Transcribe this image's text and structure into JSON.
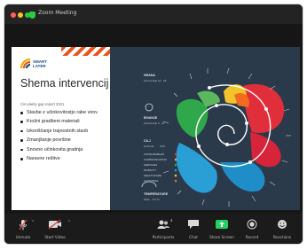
{
  "window": {
    "title": "Zoom Meeting",
    "traffic_lights": [
      "#ff5f57",
      "#febc2e",
      "#28c840"
    ]
  },
  "slide": {
    "logo": {
      "line1": "SMART",
      "line2": "LATER"
    },
    "title": "Shema intervencij",
    "subtitle": "Circularity gap report 2021",
    "bullets": [
      "Stavbe z učinkovitostjo rabe virov",
      "Krožni gradbeni materiali",
      "Izkoriščanje trajnostnih stavb",
      "Zmanjšanje površine",
      "Snovno učinkovita gradnja",
      "Naravne rešitve"
    ]
  },
  "diagram": {
    "legend": {
      "section1_title": "HRANA",
      "section1_sub": "intervencije 14 · 18",
      "section2_title": "BIVANJE",
      "section2_sub": "intervencije 6 · 21",
      "section3_title": "CILJ",
      "section3_sub": "krožnost",
      "categories": [
        "CONSUMABLES",
        "COMMUNICATION",
        "SERVICES",
        "MOBILITY",
        "HEALTHCARE",
        "ACTIVITIES"
      ],
      "category_colors": [
        "#e02f3a",
        "#e8a33d",
        "#2ea84a",
        "#2a9fd6",
        "#f2c42c",
        "#f46a1f"
      ],
      "footer_title": "TEMPERATURE",
      "footer_sub": "2021 · 3.0 °C"
    }
  },
  "toolbar": {
    "unmute_label": "Unmute",
    "video_label": "Start Video",
    "participants_label": "Participants",
    "participants_count": "4",
    "chat_label": "Chat",
    "share_label": "Share Screen",
    "record_label": "Record",
    "reactions_label": "Reactions",
    "share_color": "#23d160"
  }
}
